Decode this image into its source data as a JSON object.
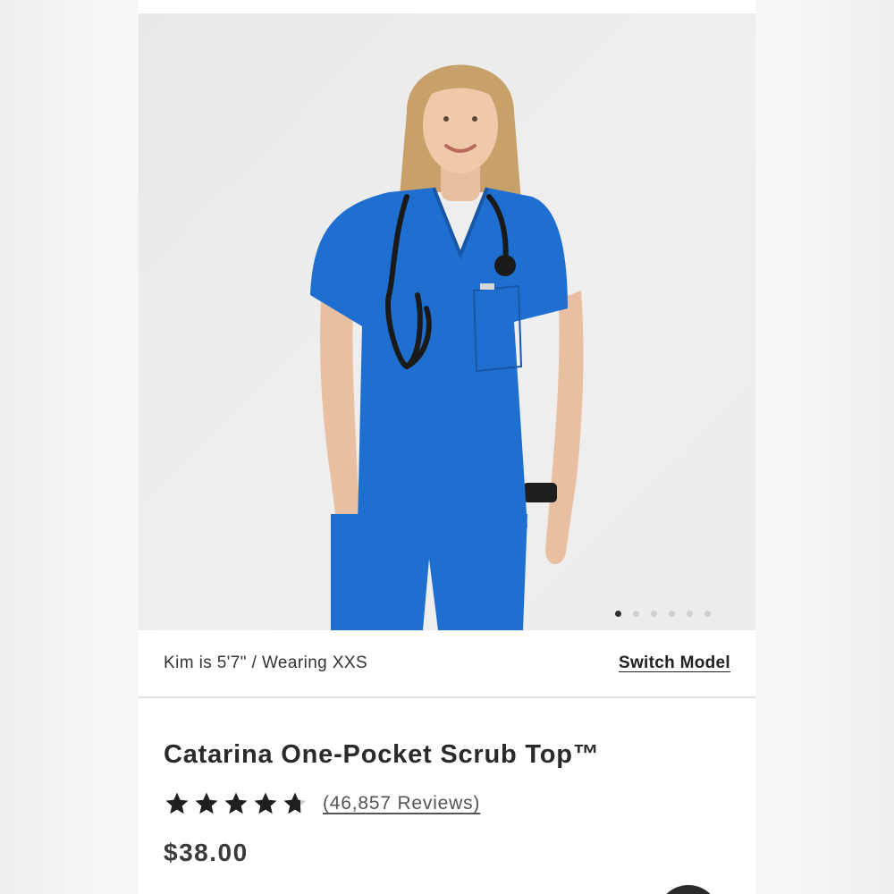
{
  "gallery": {
    "image_subject": "Model wearing royal blue one-pocket scrub top with stethoscope",
    "slide_count": 6,
    "active_slide": 1
  },
  "model_bar": {
    "model_info": "Kim is 5'7\" / Wearing XXS",
    "switch_label": "Switch Model"
  },
  "product": {
    "title": "Catarina One-Pocket Scrub Top™",
    "rating": 4.7,
    "rating_max": 5,
    "reviews_label": "(46,857 Reviews)",
    "price": "$38.00",
    "color": "#1f6fd1"
  },
  "icons": {
    "star": "star-icon",
    "half_star": "star-partial-icon",
    "carousel_dot": "carousel-dot-icon"
  }
}
